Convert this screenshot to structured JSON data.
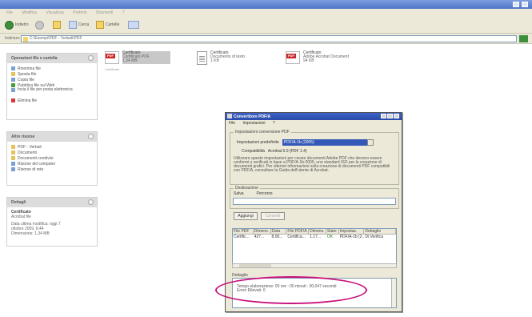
{
  "menubar": {
    "items": [
      "File",
      "Modifica",
      "Visualizza",
      "Preferiti",
      "Strumenti",
      "?"
    ]
  },
  "toolbar": {
    "back_label": "Indietro",
    "search_label": "Cerca",
    "folders_label": "Cartelle"
  },
  "addressbar": {
    "label": "Indirizzo",
    "value": "C:\\Esempi\\PDF - Verbali\\PDF"
  },
  "left_panes": {
    "file_tasks": {
      "title": "Operazioni file e cartella",
      "items": [
        "Rinomina file",
        "Sposta file",
        "Copia file",
        "Pubblica file sul Web",
        "Invia il file per posta elettronica",
        "Elimina file"
      ]
    },
    "other_places": {
      "title": "Altre risorse",
      "items": [
        "PDF - Verbali",
        "Documenti",
        "Documenti condivisi",
        "Risorse del computer",
        "Risorse di rete"
      ]
    },
    "details": {
      "title": "Dettagli",
      "file_name": "Certificato",
      "file_type": "Acrobat file",
      "modified": "Data ultima modifica: oggi 7",
      "modified_2": "ottobre 2009, 8.44",
      "size": "Dimensione: 1,34 MB"
    }
  },
  "files": [
    {
      "name": "Certificato",
      "sub": "Certificato PDF",
      "sub2": "1,34 MB",
      "badge": "PDF",
      "under": "Certificato"
    },
    {
      "name": "Certificato",
      "sub": "Documento di testo",
      "sub2": "1 KB"
    },
    {
      "name": "Certificato",
      "sub": "Adobe Acrobat Document",
      "sub2": "94 KB",
      "badge": "PDF"
    }
  ],
  "dialog": {
    "title": "Convertitore PDF/A",
    "menu": [
      "File",
      "Impostazioni",
      "?"
    ],
    "conversion_group": "Impostazioni conversione PDF",
    "profile_label": "Impostazioni predefinite",
    "profile_value": "PDF/A-1b (2005)",
    "compat_label": "Compatibilità",
    "compat_value": "Acrobat 5.0 (PDF 1.4)",
    "description": "Utilizzare queste impostazioni per creare documenti Adobe PDF che devono essere conformi o verificati in base a PDF/A-1b:2005, uno standard ISO per la creazione di documenti grafici. Per ulteriori informazioni sulla creazione di documenti PDF compatibili con PDF/A, consultare la Guida dell'utente di Acrobat.",
    "target_group": "Destinazione",
    "target_save_label": "Salva",
    "target_path_label": "Percorso",
    "btn_add": "Aggiungi",
    "btn_convert": "Converti",
    "columns": [
      "File PDF",
      "Dimens.",
      "Data",
      "File PDF/A",
      "Dimens.",
      "Stato",
      "Impostaz.",
      "Dettaglio"
    ],
    "row": [
      "Certific...",
      "427...",
      "8.00...",
      "Certifica...",
      "1.17...",
      "OK",
      "PDF/A-1b (2...",
      "Di Verifica"
    ],
    "log_label": "Dettaglio",
    "log_line1": "Tempo elaborazione: 00 ore : 00 minuti : 00,047 secondi",
    "log_line2": "Errori Rilevati: 0"
  }
}
